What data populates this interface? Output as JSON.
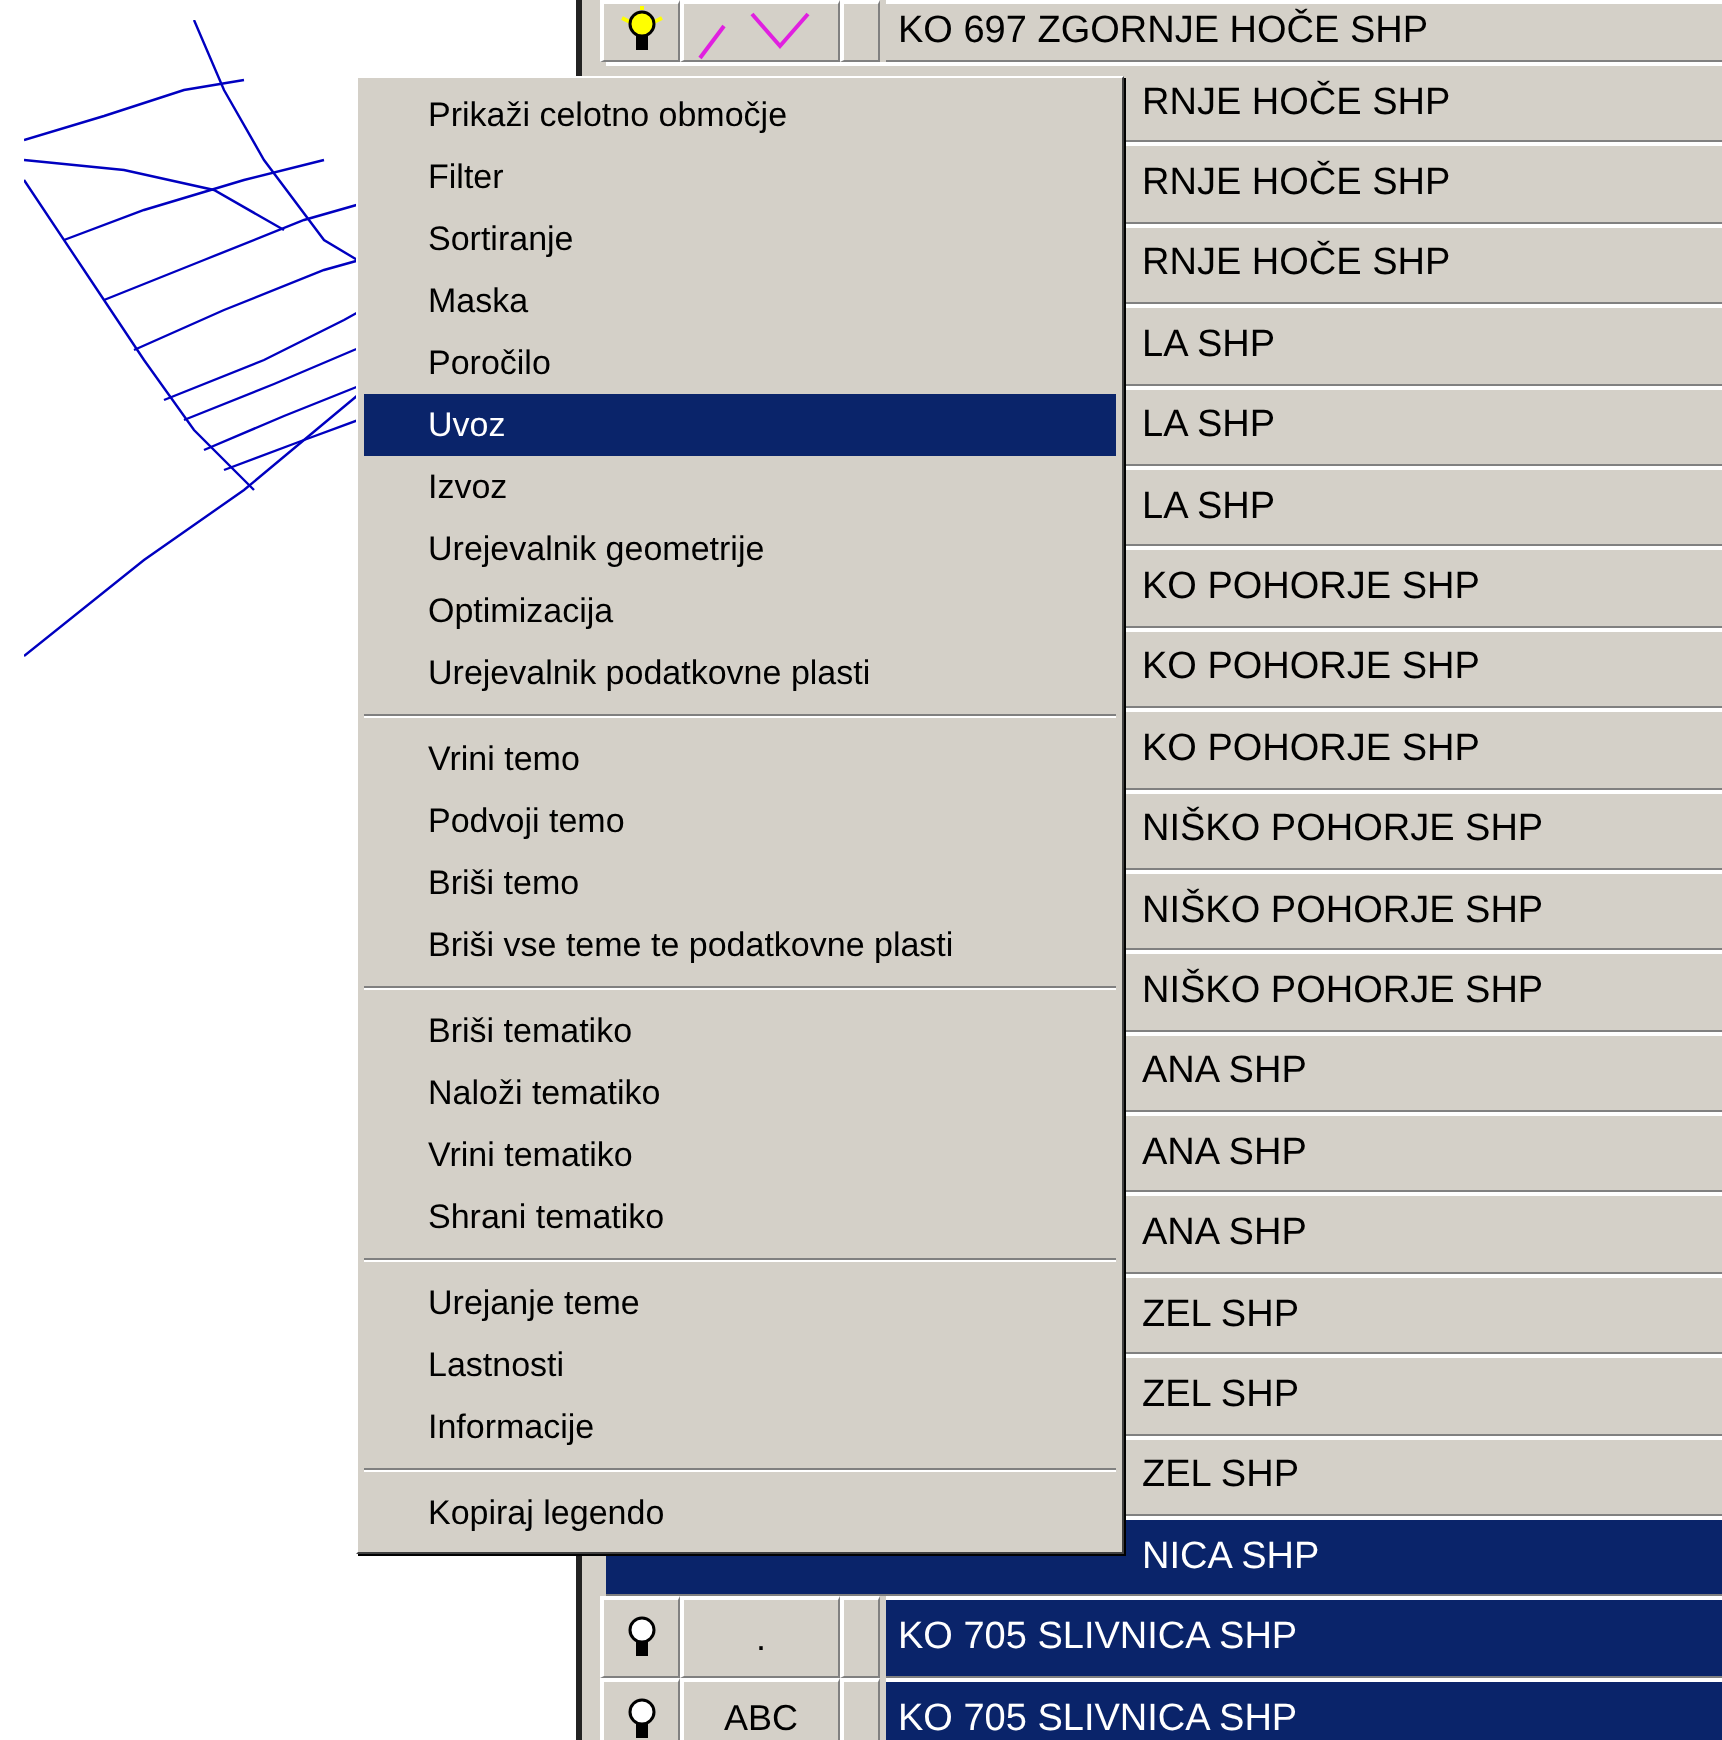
{
  "legend": {
    "rows": [
      {
        "lamp_on": true,
        "symbol": {
          "kind": "line"
        },
        "text": "KO 697 ZGORNJE HOČE SHP",
        "partial": false,
        "selected": false
      },
      {
        "text": "RNJE HOČE SHP",
        "partial": true,
        "selected": false
      },
      {
        "text": "RNJE HOČE SHP",
        "partial": true,
        "selected": false
      },
      {
        "text": "RNJE HOČE SHP",
        "partial": true,
        "selected": false
      },
      {
        "text": "LA SHP",
        "partial": true,
        "selected": false
      },
      {
        "text": "LA SHP",
        "partial": true,
        "selected": false
      },
      {
        "text": "LA SHP",
        "partial": true,
        "selected": false
      },
      {
        "text": "KO POHORJE SHP",
        "partial": true,
        "selected": false
      },
      {
        "text": "KO POHORJE SHP",
        "partial": true,
        "selected": false
      },
      {
        "text": "KO POHORJE SHP",
        "partial": true,
        "selected": false
      },
      {
        "text": "NIŠKO POHORJE SHP",
        "partial": true,
        "selected": false
      },
      {
        "text": "NIŠKO POHORJE SHP",
        "partial": true,
        "selected": false
      },
      {
        "text": "NIŠKO POHORJE SHP",
        "partial": true,
        "selected": false
      },
      {
        "text": "ANA SHP",
        "partial": true,
        "selected": false
      },
      {
        "text": "ANA SHP",
        "partial": true,
        "selected": false
      },
      {
        "text": "ANA SHP",
        "partial": true,
        "selected": false
      },
      {
        "text": "ZEL SHP",
        "partial": true,
        "selected": false
      },
      {
        "text": "ZEL SHP",
        "partial": true,
        "selected": false
      },
      {
        "text": "ZEL SHP",
        "partial": true,
        "selected": false
      },
      {
        "text": "NICA SHP",
        "partial": true,
        "selected": true
      },
      {
        "lamp_on": false,
        "symbol": {
          "kind": "label",
          "text": "."
        },
        "text": "KO 705 SLIVNICA SHP",
        "partial": false,
        "selected": true
      },
      {
        "lamp_on": false,
        "symbol": {
          "kind": "label",
          "text": "ABC"
        },
        "text": "KO 705 SLIVNICA SHP",
        "partial": false,
        "selected": true
      }
    ]
  },
  "context_menu": {
    "groups": [
      [
        {
          "label": "Prikaži celotno območje",
          "selected": false
        },
        {
          "label": "Filter",
          "selected": false
        },
        {
          "label": "Sortiranje",
          "selected": false
        },
        {
          "label": "Maska",
          "selected": false
        },
        {
          "label": "Poročilo",
          "selected": false
        },
        {
          "label": "Uvoz",
          "selected": true
        },
        {
          "label": "Izvoz",
          "selected": false
        },
        {
          "label": "Urejevalnik geometrije",
          "selected": false
        },
        {
          "label": "Optimizacija",
          "selected": false
        },
        {
          "label": "Urejevalnik podatkovne plasti",
          "selected": false
        }
      ],
      [
        {
          "label": "Vrini temo",
          "selected": false
        },
        {
          "label": "Podvoji temo",
          "selected": false
        },
        {
          "label": "Briši temo",
          "selected": false
        },
        {
          "label": "Briši vse teme te podatkovne plasti",
          "selected": false
        }
      ],
      [
        {
          "label": "Briši tematiko",
          "selected": false
        },
        {
          "label": "Naloži tematiko",
          "selected": false
        },
        {
          "label": "Vrini tematiko",
          "selected": false
        },
        {
          "label": "Shrani tematiko",
          "selected": false
        }
      ],
      [
        {
          "label": "Urejanje teme",
          "selected": false
        },
        {
          "label": "Lastnosti",
          "selected": false
        },
        {
          "label": "Informacije",
          "selected": false
        }
      ],
      [
        {
          "label": "Kopiraj legendo",
          "selected": false
        }
      ]
    ]
  }
}
